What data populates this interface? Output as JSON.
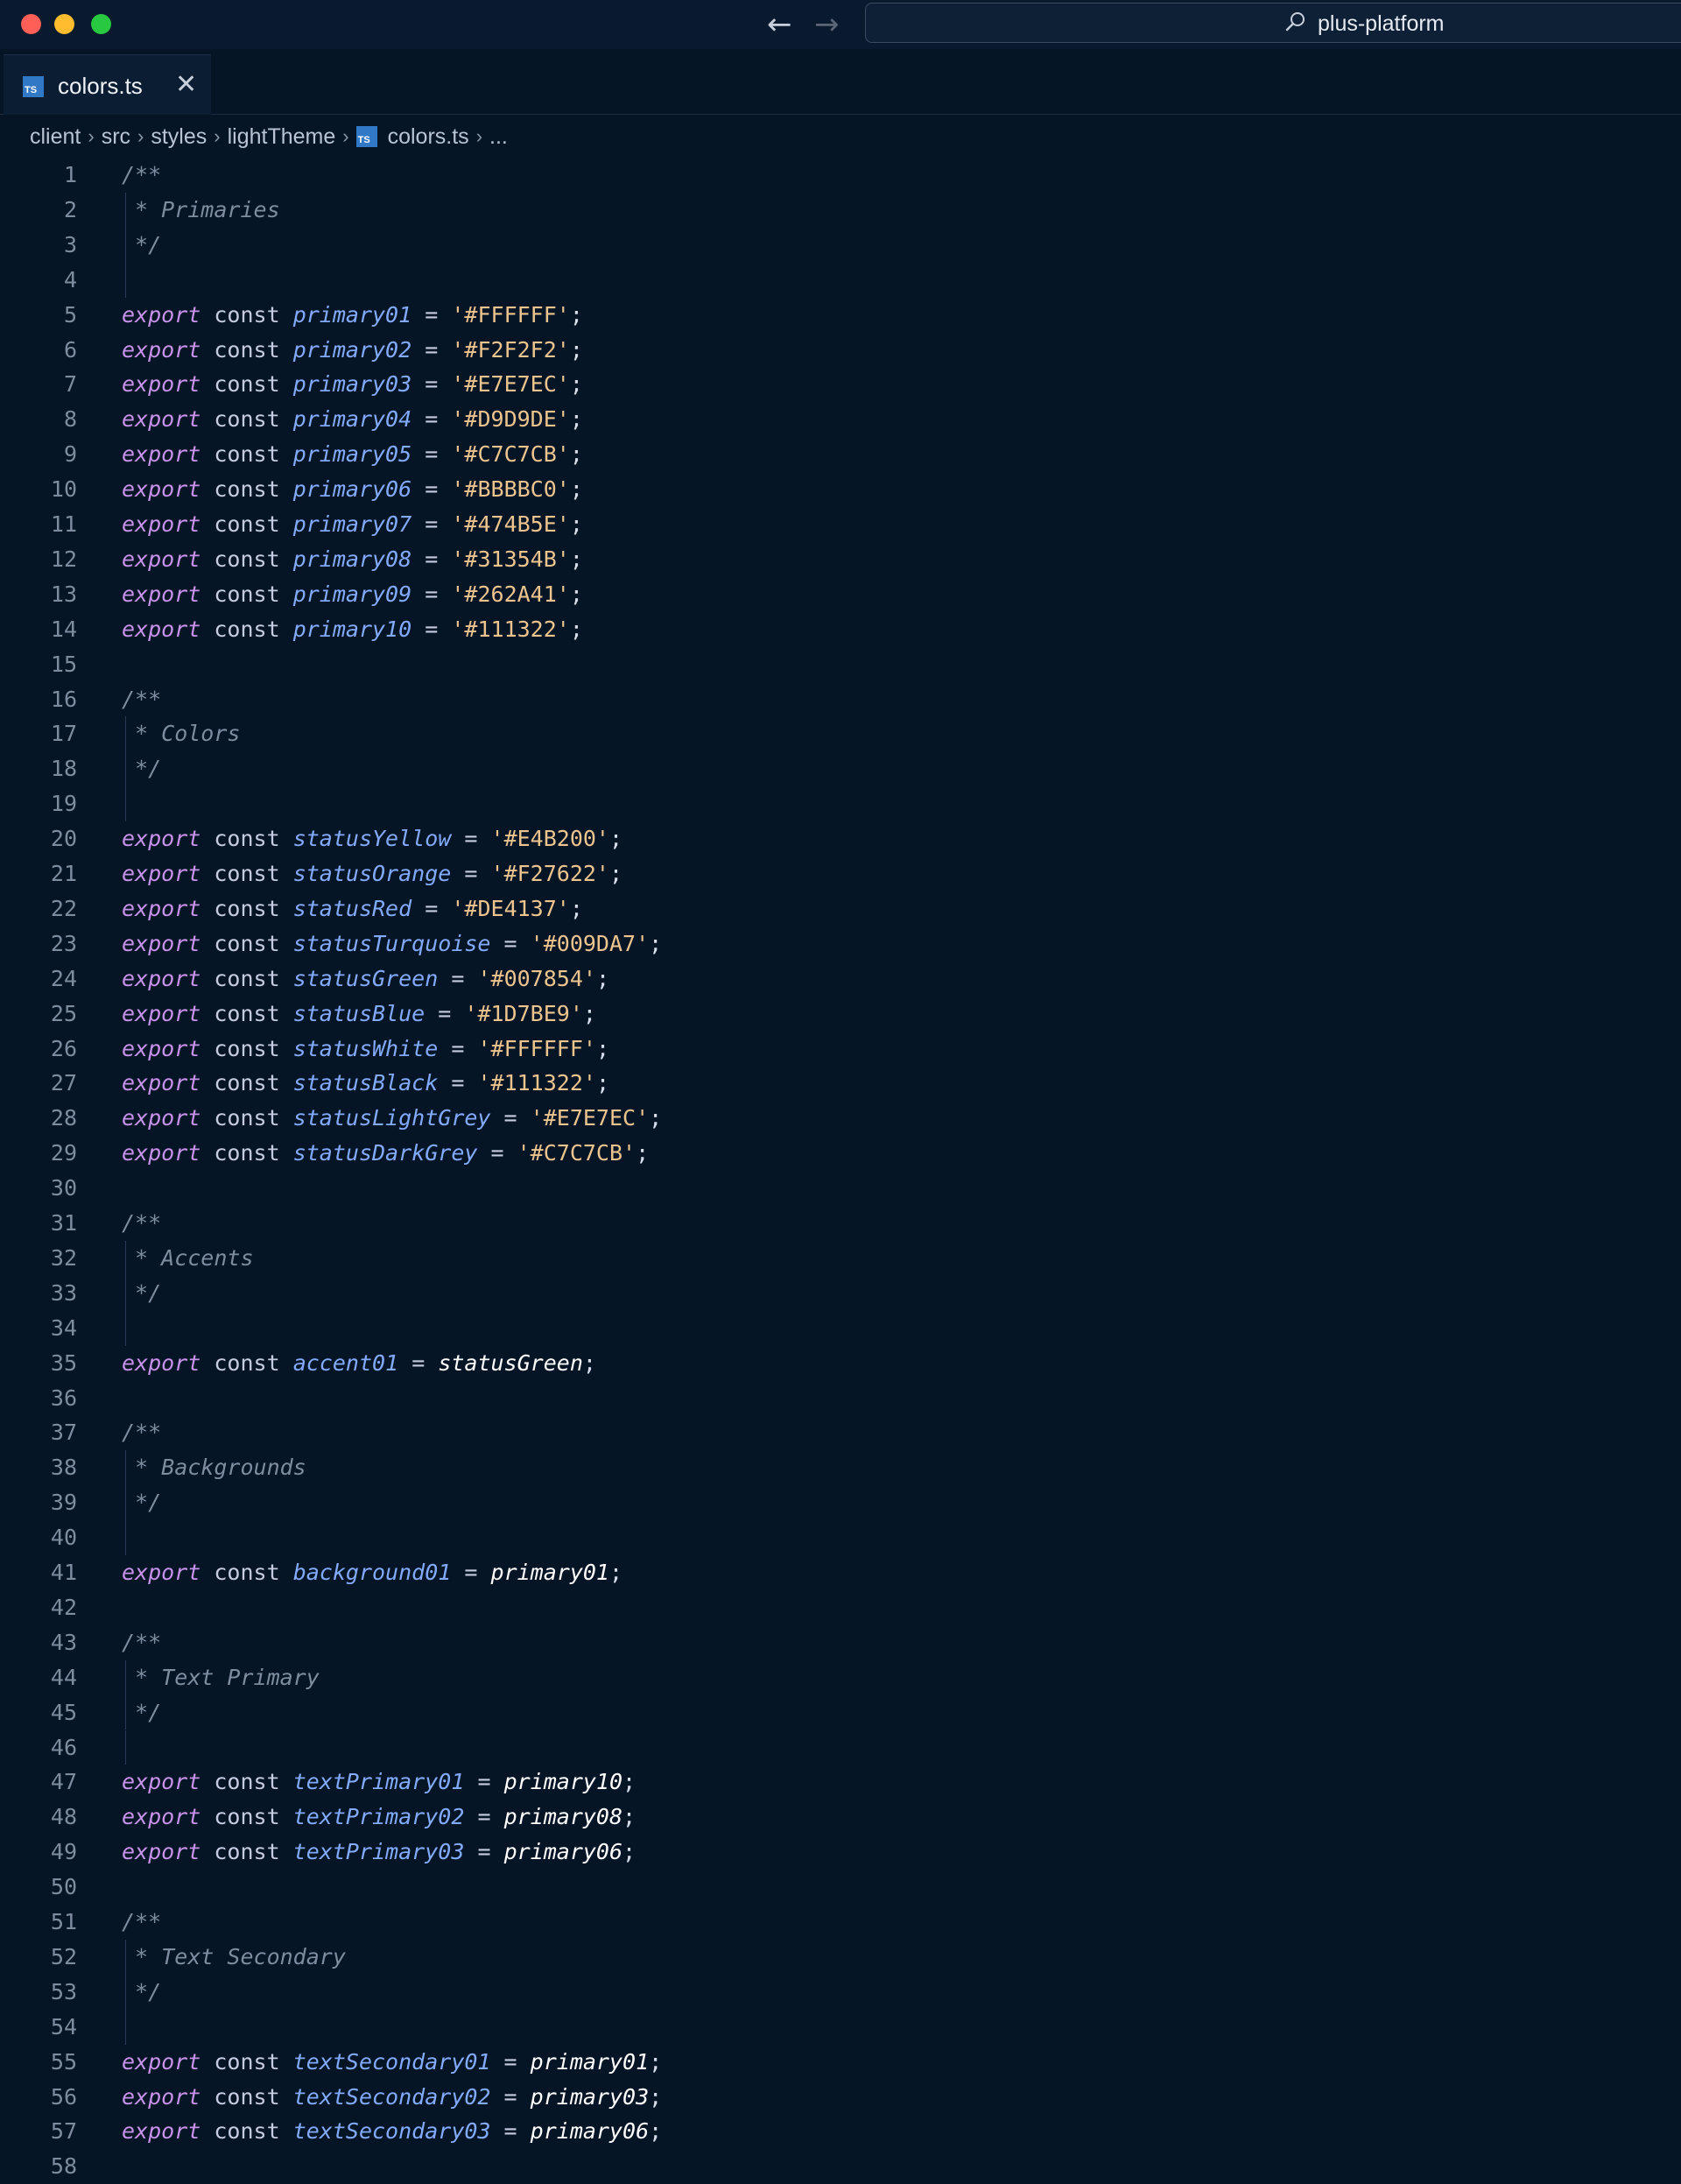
{
  "window": {
    "search_text": "plus-platform",
    "nav_back": "←",
    "nav_forward": "→"
  },
  "tabs": [
    {
      "label": "colors.ts",
      "icon": "ts-file-icon",
      "active": true,
      "close": "✕"
    }
  ],
  "breadcrumb": [
    "client",
    "src",
    "styles",
    "lightTheme",
    "colors.ts",
    "..."
  ],
  "editor": {
    "lines": [
      {
        "n": "1",
        "type": "comment",
        "text": "/**"
      },
      {
        "n": "2",
        "type": "comment",
        "text": " * Primaries"
      },
      {
        "n": "3",
        "type": "comment",
        "text": " */"
      },
      {
        "n": "4",
        "type": "blank",
        "guide": true
      },
      {
        "n": "5",
        "type": "export",
        "name": "primary01",
        "value": "'#FFFFFF'"
      },
      {
        "n": "6",
        "type": "export",
        "name": "primary02",
        "value": "'#F2F2F2'"
      },
      {
        "n": "7",
        "type": "export",
        "name": "primary03",
        "value": "'#E7E7EC'"
      },
      {
        "n": "8",
        "type": "export",
        "name": "primary04",
        "value": "'#D9D9DE'"
      },
      {
        "n": "9",
        "type": "export",
        "name": "primary05",
        "value": "'#C7C7CB'"
      },
      {
        "n": "10",
        "type": "export",
        "name": "primary06",
        "value": "'#BBBBC0'"
      },
      {
        "n": "11",
        "type": "export",
        "name": "primary07",
        "value": "'#474B5E'"
      },
      {
        "n": "12",
        "type": "export",
        "name": "primary08",
        "value": "'#31354B'"
      },
      {
        "n": "13",
        "type": "export",
        "name": "primary09",
        "value": "'#262A41'"
      },
      {
        "n": "14",
        "type": "export",
        "name": "primary10",
        "value": "'#111322'"
      },
      {
        "n": "15",
        "type": "blank"
      },
      {
        "n": "16",
        "type": "comment",
        "text": "/**"
      },
      {
        "n": "17",
        "type": "comment",
        "text": " * Colors"
      },
      {
        "n": "18",
        "type": "comment",
        "text": " */"
      },
      {
        "n": "19",
        "type": "blank",
        "guide": true
      },
      {
        "n": "20",
        "type": "export",
        "name": "statusYellow",
        "value": "'#E4B200'"
      },
      {
        "n": "21",
        "type": "export",
        "name": "statusOrange",
        "value": "'#F27622'"
      },
      {
        "n": "22",
        "type": "export",
        "name": "statusRed",
        "value": "'#DE4137'"
      },
      {
        "n": "23",
        "type": "export",
        "name": "statusTurquoise",
        "value": "'#009DA7'"
      },
      {
        "n": "24",
        "type": "export",
        "name": "statusGreen",
        "value": "'#007854'"
      },
      {
        "n": "25",
        "type": "export",
        "name": "statusBlue",
        "value": "'#1D7BE9'"
      },
      {
        "n": "26",
        "type": "export",
        "name": "statusWhite",
        "value": "'#FFFFFF'"
      },
      {
        "n": "27",
        "type": "export",
        "name": "statusBlack",
        "value": "'#111322'"
      },
      {
        "n": "28",
        "type": "export",
        "name": "statusLightGrey",
        "value": "'#E7E7EC'"
      },
      {
        "n": "29",
        "type": "export",
        "name": "statusDarkGrey",
        "value": "'#C7C7CB'"
      },
      {
        "n": "30",
        "type": "blank"
      },
      {
        "n": "31",
        "type": "comment",
        "text": "/**"
      },
      {
        "n": "32",
        "type": "comment",
        "text": " * Accents"
      },
      {
        "n": "33",
        "type": "comment",
        "text": " */"
      },
      {
        "n": "34",
        "type": "blank",
        "guide": true
      },
      {
        "n": "35",
        "type": "export",
        "name": "accent01",
        "ref": "statusGreen"
      },
      {
        "n": "36",
        "type": "blank"
      },
      {
        "n": "37",
        "type": "comment",
        "text": "/**"
      },
      {
        "n": "38",
        "type": "comment",
        "text": " * Backgrounds"
      },
      {
        "n": "39",
        "type": "comment",
        "text": " */"
      },
      {
        "n": "40",
        "type": "blank",
        "guide": true
      },
      {
        "n": "41",
        "type": "export",
        "name": "background01",
        "ref": "primary01"
      },
      {
        "n": "42",
        "type": "blank"
      },
      {
        "n": "43",
        "type": "comment",
        "text": "/**"
      },
      {
        "n": "44",
        "type": "comment",
        "text": " * Text Primary"
      },
      {
        "n": "45",
        "type": "comment",
        "text": " */"
      },
      {
        "n": "46",
        "type": "blank",
        "guide": true
      },
      {
        "n": "47",
        "type": "export",
        "name": "textPrimary01",
        "ref": "primary10"
      },
      {
        "n": "48",
        "type": "export",
        "name": "textPrimary02",
        "ref": "primary08"
      },
      {
        "n": "49",
        "type": "export",
        "name": "textPrimary03",
        "ref": "primary06"
      },
      {
        "n": "50",
        "type": "blank"
      },
      {
        "n": "51",
        "type": "comment",
        "text": "/**"
      },
      {
        "n": "52",
        "type": "comment",
        "text": " * Text Secondary"
      },
      {
        "n": "53",
        "type": "comment",
        "text": " */"
      },
      {
        "n": "54",
        "type": "blank",
        "guide": true
      },
      {
        "n": "55",
        "type": "export",
        "name": "textSecondary01",
        "ref": "primary01"
      },
      {
        "n": "56",
        "type": "export",
        "name": "textSecondary02",
        "ref": "primary03"
      },
      {
        "n": "57",
        "type": "export",
        "name": "textSecondary03",
        "ref": "primary06"
      },
      {
        "n": "58",
        "type": "blank"
      }
    ],
    "keywords": {
      "export": "export",
      "const": "const",
      "eq": "=",
      "semi": ";"
    }
  },
  "colors": {
    "background": "#061526",
    "keyword": "#c792ea",
    "identifier": "#82aaff",
    "string": "#ecc48d",
    "comment": "#7f8ca0"
  }
}
